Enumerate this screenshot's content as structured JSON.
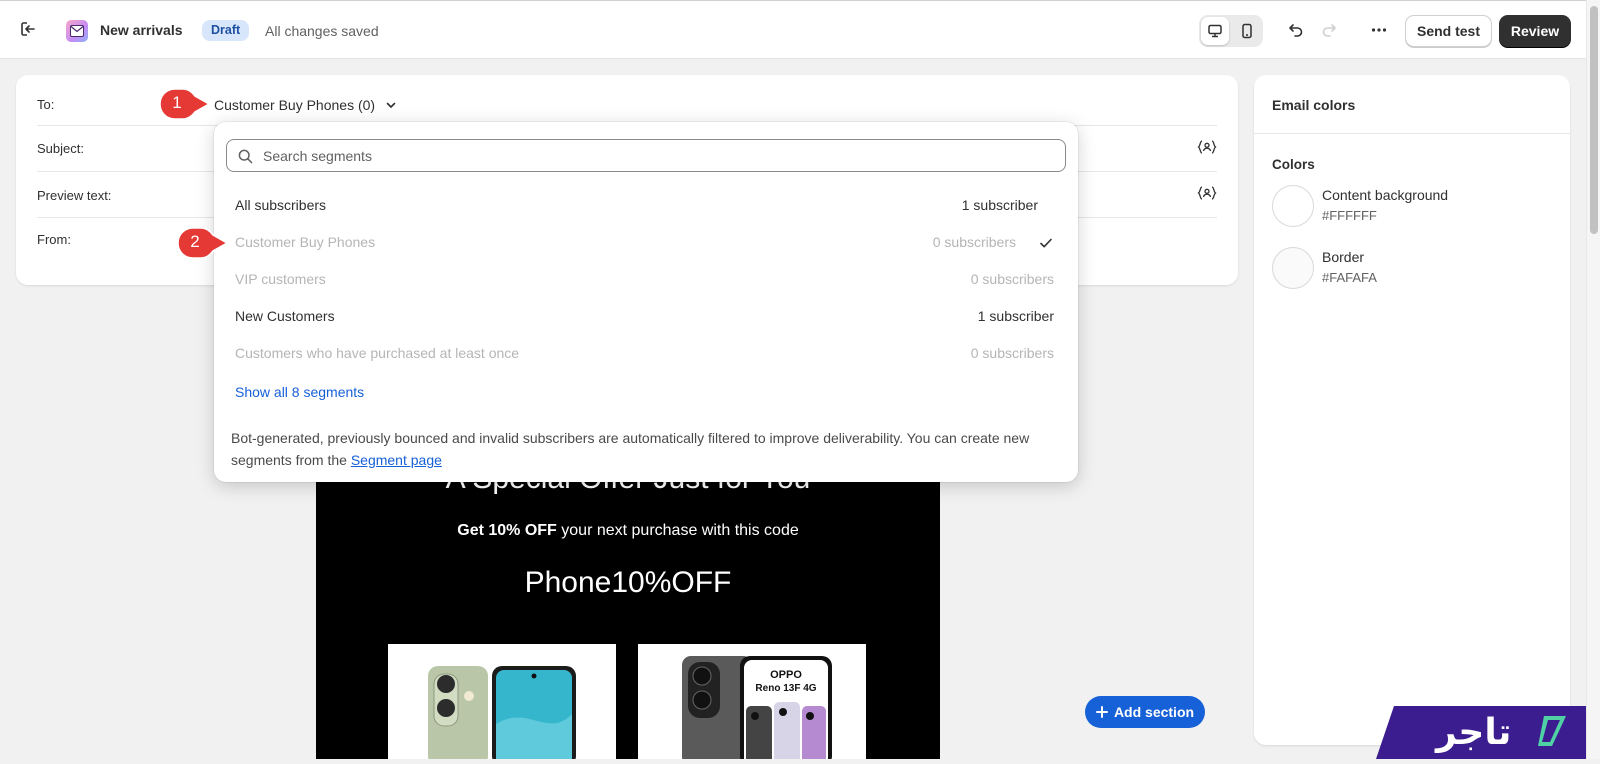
{
  "header": {
    "title": "New arrivals",
    "status_badge": "Draft",
    "save_status": "All changes saved",
    "send_test_label": "Send test",
    "review_label": "Review"
  },
  "form": {
    "to_label": "To:",
    "to_value": "Customer Buy Phones (0)",
    "subject_label": "Subject:",
    "preview_label": "Preview text:",
    "from_label": "From:"
  },
  "dropdown": {
    "search_placeholder": "Search segments",
    "segments": [
      {
        "name": "All subscribers",
        "count": "1 subscriber",
        "enabled": true,
        "selected": false
      },
      {
        "name": "Customer Buy Phones",
        "count": "0 subscribers",
        "enabled": false,
        "selected": true
      },
      {
        "name": "VIP customers",
        "count": "0 subscribers",
        "enabled": false,
        "selected": false
      },
      {
        "name": "New Customers",
        "count": "1 subscriber",
        "enabled": true,
        "selected": false
      },
      {
        "name": "Customers who have purchased at least once",
        "count": "0 subscribers",
        "enabled": false,
        "selected": false
      }
    ],
    "show_all": "Show all 8 segments",
    "note_text": "Bot-generated, previously bounced and invalid subscribers are automatically filtered to improve deliverability. You can create new segments from the ",
    "note_link": "Segment page"
  },
  "email": {
    "headline": "A Special Offer Just for You",
    "offer_bold": "Get 10% OFF",
    "offer_rest": " your next purchase with this code",
    "code": "Phone10%OFF",
    "product2_brand": "OPPO",
    "product2_model": "Reno 13F 4G"
  },
  "canvas": {
    "add_section_label": "Add section"
  },
  "panel": {
    "title": "Email colors",
    "colors_heading": "Colors",
    "colors": [
      {
        "name": "Content background",
        "hex": "#FFFFFF"
      },
      {
        "name": "Border",
        "hex": "#FAFAFA"
      }
    ]
  },
  "markers": {
    "step1": "1",
    "step2": "2"
  },
  "brand": {
    "logo_text": "تاجر"
  },
  "colors": {
    "accent_blue": "#1660d8",
    "marker_red": "#e53935",
    "brand_purple": "#3b1d8f"
  }
}
